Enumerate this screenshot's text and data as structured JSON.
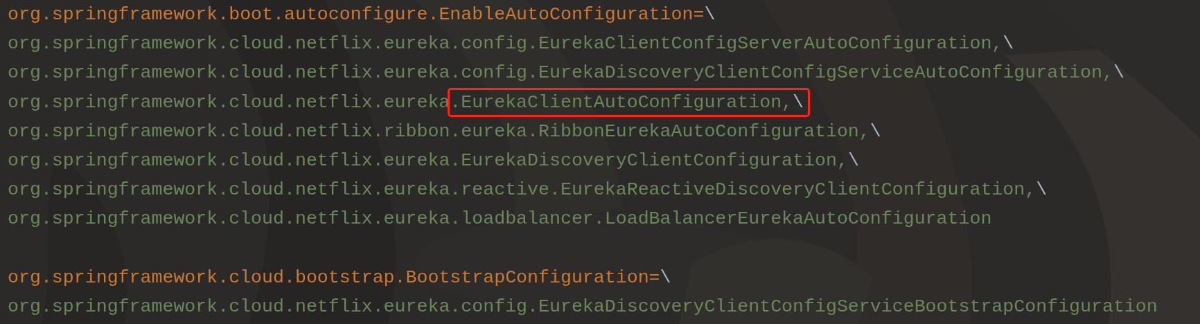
{
  "lines": [
    {
      "kind": "key",
      "segments": [
        {
          "text": "org.springframework.boot.autoconfigure.EnableAutoConfiguration=",
          "highlighted": false
        }
      ],
      "continuation": "\\"
    },
    {
      "kind": "value",
      "segments": [
        {
          "text": "org.springframework.cloud.netflix.eureka.config.EurekaClientConfigServerAutoConfiguration,",
          "highlighted": false
        }
      ],
      "continuation": "\\"
    },
    {
      "kind": "value",
      "segments": [
        {
          "text": "org.springframework.cloud.netflix.eureka.config.EurekaDiscoveryClientConfigServiceAutoConfiguration,",
          "highlighted": false
        }
      ],
      "continuation": "\\"
    },
    {
      "kind": "value",
      "segments": [
        {
          "text": "org.springframework.cloud.netflix.eureka",
          "highlighted": false
        },
        {
          "text": ".EurekaClientAutoConfiguration,",
          "highlighted": true
        }
      ],
      "continuation": "\\"
    },
    {
      "kind": "value",
      "segments": [
        {
          "text": "org.springframework.cloud.netflix.ribbon.eureka.RibbonEurekaAutoConfiguration,",
          "highlighted": false
        }
      ],
      "continuation": "\\"
    },
    {
      "kind": "value",
      "segments": [
        {
          "text": "org.springframework.cloud.netflix.eureka.EurekaDiscoveryClientConfiguration,",
          "highlighted": false
        }
      ],
      "continuation": "\\"
    },
    {
      "kind": "value",
      "segments": [
        {
          "text": "org.springframework.cloud.netflix.eureka.reactive.EurekaReactiveDiscoveryClientConfiguration,",
          "highlighted": false
        }
      ],
      "continuation": "\\"
    },
    {
      "kind": "value",
      "segments": [
        {
          "text": "org.springframework.cloud.netflix.eureka.loadbalancer.LoadBalancerEurekaAutoConfiguration",
          "highlighted": false
        }
      ]
    },
    {
      "kind": "blank"
    },
    {
      "kind": "key",
      "segments": [
        {
          "text": "org.springframework.cloud.bootstrap.BootstrapConfiguration=",
          "highlighted": false
        }
      ],
      "continuation": "\\"
    },
    {
      "kind": "value",
      "segments": [
        {
          "text": "org.springframework.cloud.netflix.eureka.config.EurekaDiscoveryClientConfigServiceBootstrapConfiguration",
          "highlighted": false
        }
      ]
    }
  ]
}
